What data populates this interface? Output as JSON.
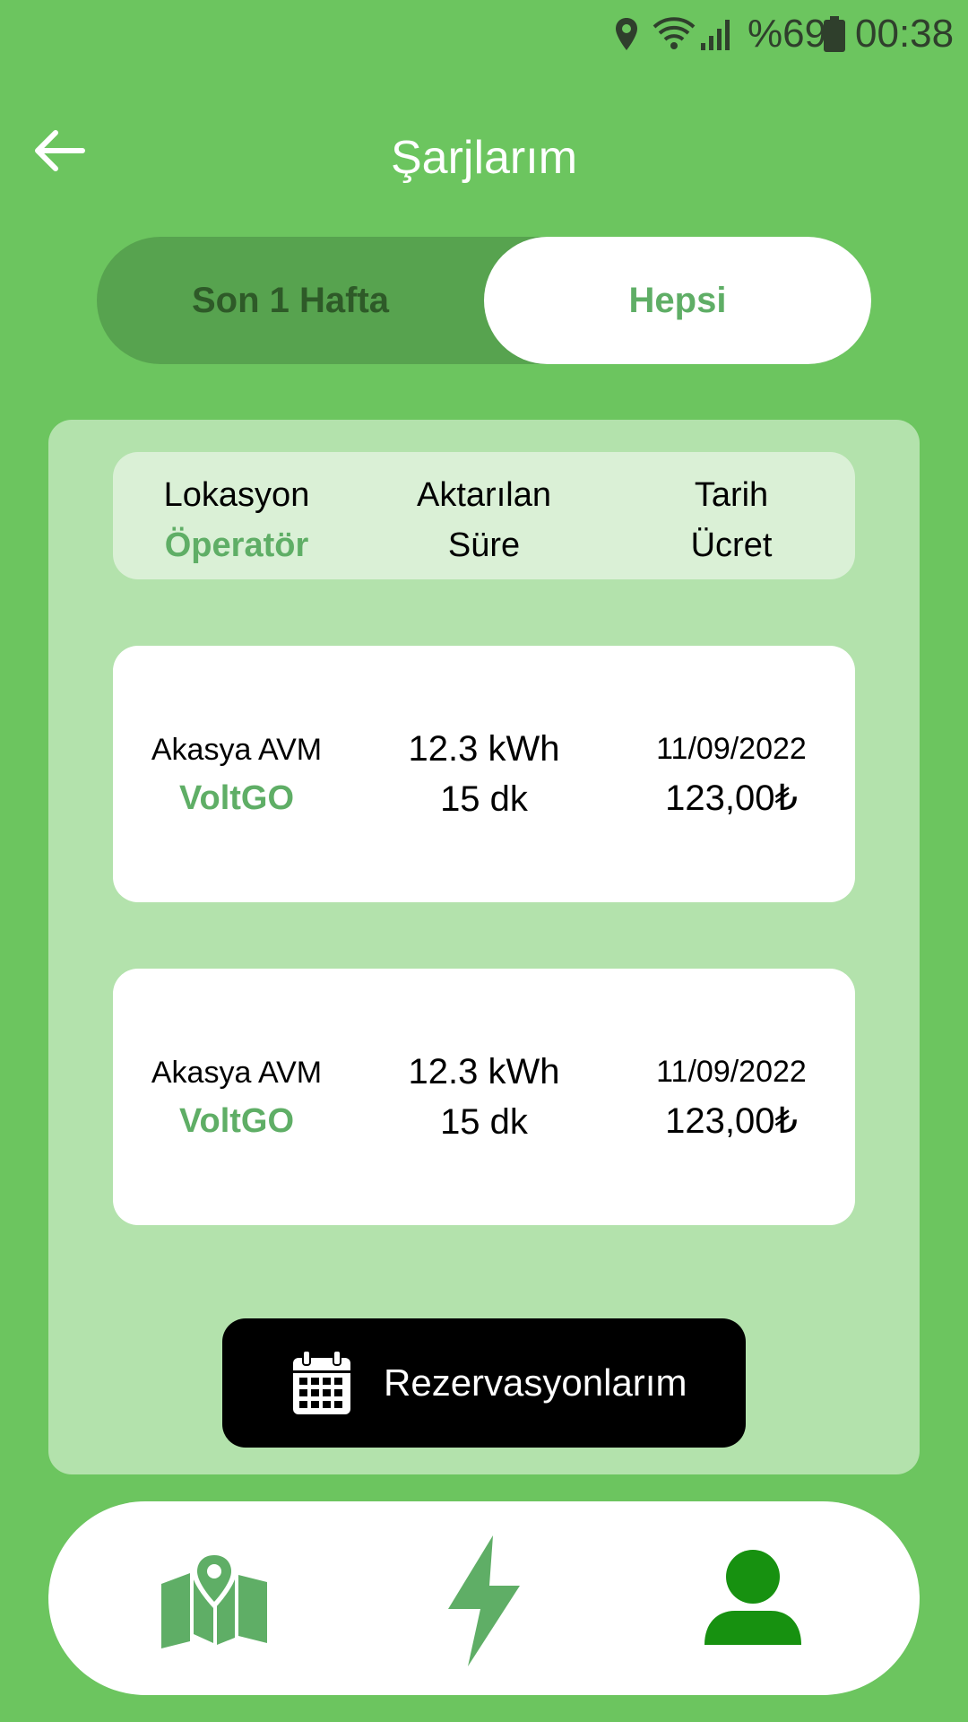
{
  "status_bar": {
    "battery_text": "%69",
    "time": "00:38",
    "icons": [
      "location-icon",
      "wifi-icon",
      "signal-icon",
      "battery-icon"
    ]
  },
  "header": {
    "title": "Şarjlarım",
    "back_icon": "arrow-left-icon"
  },
  "segment": {
    "options": [
      "Son 1 Hafta",
      "Hepsi"
    ],
    "selected": "Hepsi"
  },
  "table_header": {
    "col1": {
      "line1": "Lokasyon",
      "line2": "Öperatör"
    },
    "col2": {
      "line1": "Aktarılan",
      "line2": "Süre"
    },
    "col3": {
      "line1": "Tarih",
      "line2": "Ücret"
    }
  },
  "rows": [
    {
      "location": "Akasya AVM",
      "operator": "VoltGO",
      "energy": "12.3 kWh",
      "duration": "15 dk",
      "date": "11/09/2022",
      "price": "123,00₺"
    },
    {
      "location": "Akasya AVM",
      "operator": "VoltGO",
      "energy": "12.3 kWh",
      "duration": "15 dk",
      "date": "11/09/2022",
      "price": "123,00₺"
    }
  ],
  "reservations_button": {
    "label": "Rezervasyonlarım",
    "icon": "calendar-icon"
  },
  "bottom_nav": {
    "items": [
      {
        "icon": "map-icon",
        "active": false
      },
      {
        "icon": "lightning-icon",
        "active": false
      },
      {
        "icon": "profile-icon",
        "active": true
      }
    ]
  },
  "colors": {
    "background": "#6cc55f",
    "panel": "#b3e2ac",
    "accent_green": "#5fae66",
    "active_nav": "#179110"
  }
}
